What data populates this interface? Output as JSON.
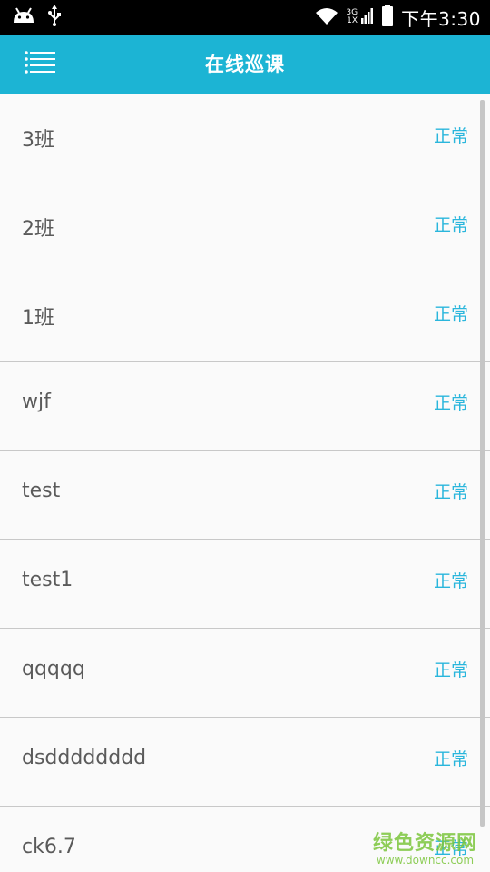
{
  "status_bar": {
    "time": "下午3:30",
    "net_top": "3G",
    "net_bottom": "1X",
    "icons": [
      "android-icon",
      "usb-icon",
      "wifi-icon",
      "signal-icon",
      "battery-icon"
    ]
  },
  "app_bar": {
    "title": "在线巡课",
    "menu_icon": "menu-icon",
    "background": "#1cb4d4"
  },
  "rows": [
    {
      "name": "3班",
      "status": "正常"
    },
    {
      "name": "2班",
      "status": "正常"
    },
    {
      "name": "1班",
      "status": "正常"
    },
    {
      "name": "wjf",
      "status": "正常"
    },
    {
      "name": "test",
      "status": "正常"
    },
    {
      "name": "test1",
      "status": "正常"
    },
    {
      "name": "qqqqq",
      "status": "正常"
    },
    {
      "name": "dsdddddddd",
      "status": "正常"
    },
    {
      "name": "ck6.7",
      "status": "正常"
    }
  ],
  "watermark": {
    "text": "绿色资源网",
    "url": "www.downcc.com"
  },
  "colors": {
    "status_text": "#2ab6dc",
    "watermark": "#7cc63c"
  }
}
